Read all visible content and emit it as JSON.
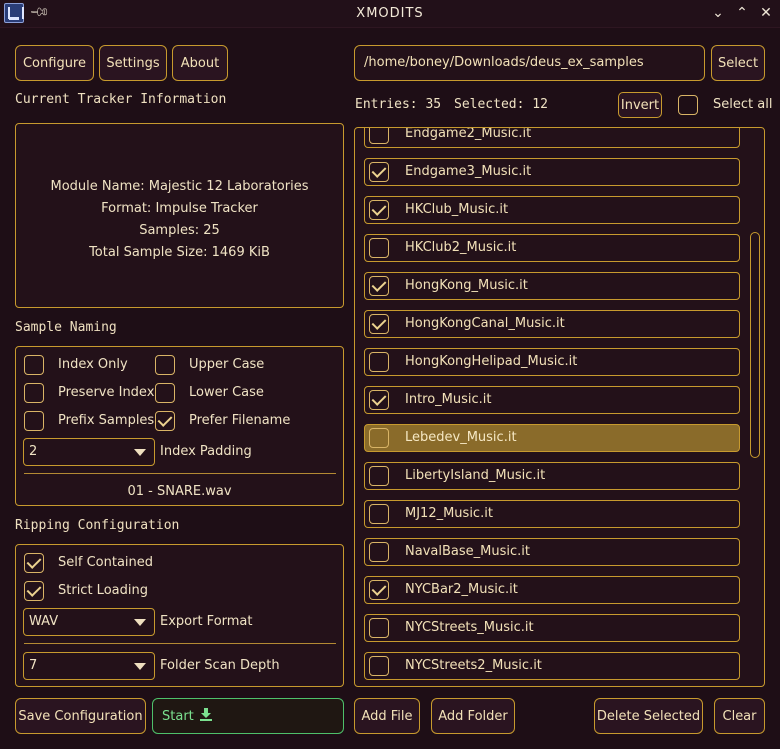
{
  "window": {
    "title": "XMODITS"
  },
  "topbar": {
    "configure": "Configure",
    "settings": "Settings",
    "about": "About",
    "select": "Select"
  },
  "path": {
    "value": "/home/boney/Downloads/deus_ex_samples"
  },
  "tracker": {
    "heading": "Current Tracker Information",
    "module_name": "Module Name: Majestic 12 Laboratories",
    "format": "Format: Impulse Tracker",
    "samples": "Samples: 25",
    "total_size": "Total Sample Size: 1469 KiB"
  },
  "entries": {
    "entries_text": "Entries: 35",
    "selected_text": "Selected: 12",
    "invert": "Invert",
    "select_all": "Select all",
    "select_all_checked": false
  },
  "naming": {
    "heading": "Sample Naming",
    "options": [
      {
        "label": "Index Only",
        "checked": false
      },
      {
        "label": "Upper Case",
        "checked": false
      },
      {
        "label": "Preserve Index",
        "checked": false
      },
      {
        "label": "Lower Case",
        "checked": false
      },
      {
        "label": "Prefix Samples",
        "checked": false
      },
      {
        "label": "Prefer Filename",
        "checked": true
      }
    ],
    "index_padding_value": "2",
    "index_padding_label": "Index Padding",
    "preview": "01 - SNARE.wav"
  },
  "ripping": {
    "heading": "Ripping Configuration",
    "self_contained": {
      "label": "Self Contained",
      "checked": true
    },
    "strict_loading": {
      "label": "Strict Loading",
      "checked": true
    },
    "export_format_value": "WAV",
    "export_format_label": "Export Format",
    "scan_depth_value": "7",
    "scan_depth_label": "Folder Scan Depth"
  },
  "files": [
    {
      "name": "Endgame2_Music.it",
      "checked": false
    },
    {
      "name": "Endgame3_Music.it",
      "checked": true
    },
    {
      "name": "HKClub_Music.it",
      "checked": true
    },
    {
      "name": "HKClub2_Music.it",
      "checked": false
    },
    {
      "name": "HongKong_Music.it",
      "checked": true
    },
    {
      "name": "HongKongCanal_Music.it",
      "checked": true
    },
    {
      "name": "HongKongHelipad_Music.it",
      "checked": false
    },
    {
      "name": "Intro_Music.it",
      "checked": true
    },
    {
      "name": "Lebedev_Music.it",
      "checked": false,
      "highlighted": true
    },
    {
      "name": "LibertyIsland_Music.it",
      "checked": false
    },
    {
      "name": "MJ12_Music.it",
      "checked": false
    },
    {
      "name": "NavalBase_Music.it",
      "checked": false
    },
    {
      "name": "NYCBar2_Music.it",
      "checked": true
    },
    {
      "name": "NYCStreets_Music.it",
      "checked": false
    },
    {
      "name": "NYCStreets2_Music.it",
      "checked": false
    }
  ],
  "bottombar": {
    "save_config": "Save Configuration",
    "start": "Start",
    "add_file": "Add File",
    "add_folder": "Add Folder",
    "delete_selected": "Delete Selected",
    "clear": "Clear"
  },
  "colors": {
    "accent": "#c79a2e",
    "background": "#1e0e16",
    "start": "#4ec06a",
    "highlight": "#8a6b2a"
  }
}
